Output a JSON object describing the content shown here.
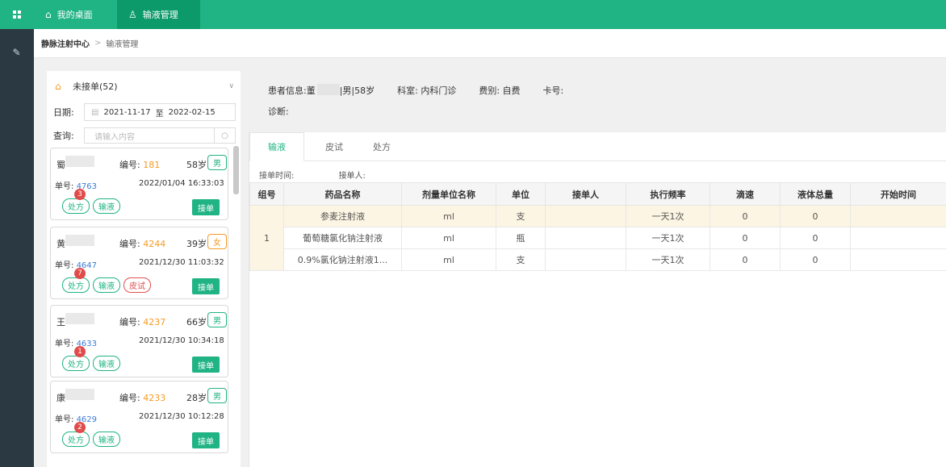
{
  "topnav": {
    "tabs": [
      {
        "label": "我的桌面",
        "icon": "home-icon"
      },
      {
        "label": "输液管理",
        "icon": "user-icon"
      }
    ]
  },
  "breadcrumb": {
    "root": "静脉注射中心",
    "current": "输液管理"
  },
  "left_panel": {
    "status_select": "未接单(52)",
    "date_label": "日期:",
    "date_from": "2021-11-17",
    "date_sep": "至",
    "date_to": "2022-02-15",
    "query_label": "查询:",
    "query_placeholder": "请输入内容"
  },
  "cards": [
    {
      "name": "蜀",
      "no_label": "编号: ",
      "no": "181",
      "age": "58岁",
      "sex": "男",
      "order_label": "单号: ",
      "order": "4763",
      "time": "2022/01/04 16:33:03",
      "badge": "3",
      "tags": [
        "处方",
        "输液"
      ],
      "button": "接单"
    },
    {
      "name": "黄",
      "no_label": "编号: ",
      "no": "4244",
      "age": "39岁",
      "sex": "女",
      "order_label": "单号: ",
      "order": "4647",
      "time": "2021/12/30 11:03:32",
      "badge": "7",
      "tags": [
        "处方",
        "输液",
        "皮试"
      ],
      "button": "接单"
    },
    {
      "name": "王",
      "no_label": "编号: ",
      "no": "4237",
      "age": "66岁",
      "sex": "男",
      "order_label": "单号: ",
      "order": "4633",
      "time": "2021/12/30 10:34:18",
      "badge": "1",
      "tags": [
        "处方",
        "输液"
      ],
      "button": "接单"
    },
    {
      "name": "康",
      "no_label": "编号: ",
      "no": "4233",
      "age": "28岁",
      "sex": "男",
      "order_label": "单号: ",
      "order": "4629",
      "time": "2021/12/30 10:12:28",
      "badge": "2",
      "tags": [
        "处方",
        "输液"
      ],
      "button": "接单"
    }
  ],
  "patient": {
    "label": "患者信息: ",
    "name": "董",
    "detail": "|男|58岁",
    "dept": "科室: 内科门诊",
    "fee": "费别: 自费",
    "card": "卡号:",
    "diagnosis": "诊断:"
  },
  "detail_tabs": [
    "输液",
    "皮试",
    "处方"
  ],
  "meta": {
    "time_label": "接单时间:",
    "user_label": "接单人:"
  },
  "table": {
    "headers": [
      "组号",
      "药品名称",
      "剂量单位名称",
      "单位",
      "接单人",
      "执行频率",
      "滴速",
      "液体总量",
      "开始时间"
    ],
    "group": "1",
    "rows": [
      [
        "参麦注射液",
        "ml",
        "支",
        "",
        "一天1次",
        "0",
        "0",
        ""
      ],
      [
        "葡萄糖氯化钠注射液",
        "ml",
        "瓶",
        "",
        "一天1次",
        "0",
        "0",
        ""
      ],
      [
        "0.9%氯化钠注射液1...",
        "ml",
        "支",
        "",
        "一天1次",
        "0",
        "0",
        ""
      ]
    ]
  },
  "colors": {
    "accent": "#20b383",
    "warn": "#f59a23",
    "danger": "#e24b4b"
  }
}
